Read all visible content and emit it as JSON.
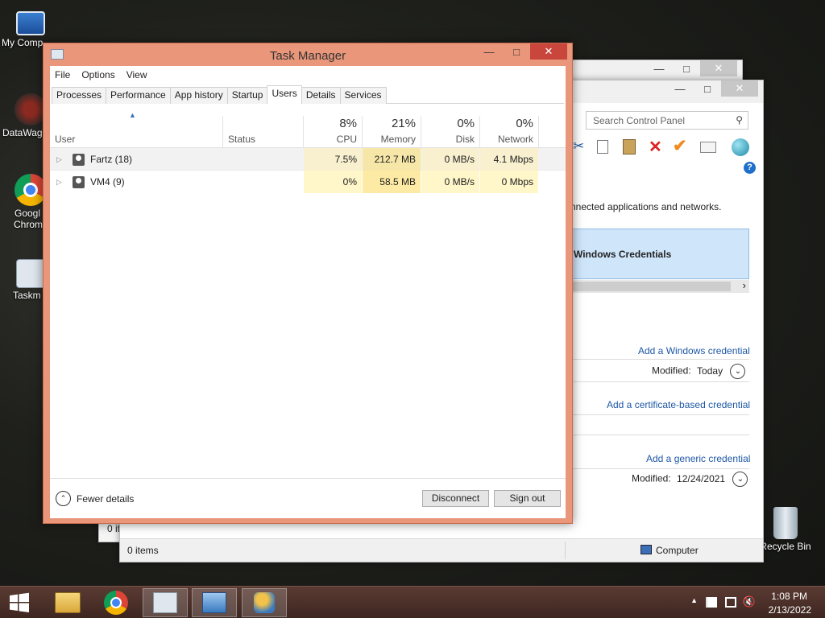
{
  "desktop": {
    "icons": [
      {
        "label": "My Comp",
        "icon": "computer-icon"
      },
      {
        "label": "DataWag",
        "icon": "datawag-icon"
      },
      {
        "label": "Googl",
        "label2": "Chrom",
        "icon": "chrome-icon"
      },
      {
        "label": "Taskm",
        "icon": "taskmanager-shortcut-icon"
      },
      {
        "label": "Recycle Bin",
        "icon": "recycle-bin-icon"
      }
    ]
  },
  "control_panel": {
    "search_placeholder": "Search Control Panel",
    "description": "nnected applications and networks.",
    "vault_title": "Windows Credentials",
    "add_windows_credential": "Add a Windows credential",
    "modified_label_1": "Modified:",
    "modified_value_1": "Today",
    "add_certificate_credential": "Add a certificate-based credential",
    "add_generic_credential": "Add a generic credential",
    "modified_label_2": "Modified:",
    "modified_value_2": "12/24/2021",
    "status_items": "0 items",
    "status_computer": "Computer",
    "partial_text": "0 it",
    "help_glyph": "?",
    "scroll_arrow": "›"
  },
  "task_manager": {
    "title": "Task Manager",
    "menu": [
      "File",
      "Options",
      "View"
    ],
    "tabs": [
      "Processes",
      "Performance",
      "App history",
      "Startup",
      "Users",
      "Details",
      "Services"
    ],
    "active_tab": "Users",
    "columns": {
      "user": "User",
      "status": "Status",
      "cpu_pct": "8%",
      "cpu": "CPU",
      "memory_pct": "21%",
      "memory": "Memory",
      "disk_pct": "0%",
      "disk": "Disk",
      "network_pct": "0%",
      "network": "Network"
    },
    "rows": [
      {
        "user": "Fartz (18)",
        "status": "",
        "cpu": "7.5%",
        "memory": "212.7 MB",
        "disk": "0 MB/s",
        "network": "4.1 Mbps"
      },
      {
        "user": "VM4 (9)",
        "status": "",
        "cpu": "0%",
        "memory": "58.5 MB",
        "disk": "0 MB/s",
        "network": "0 Mbps"
      }
    ],
    "fewer_details": "Fewer details",
    "disconnect": "Disconnect",
    "sign_out": "Sign out"
  },
  "taskbar": {
    "time": "1:08 PM",
    "date": "2/13/2022"
  },
  "colors": {
    "tm_frame": "#e9967a",
    "tm_close": "#c9463d",
    "heat_light": "#fff9d6",
    "heat_med": "#fdf0b4",
    "link": "#1e57a5"
  }
}
